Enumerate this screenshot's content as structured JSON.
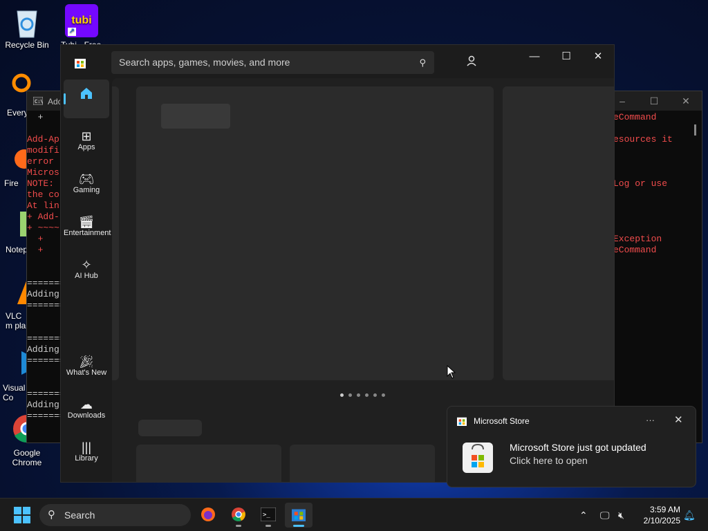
{
  "desktop": {
    "icons": [
      {
        "label": "Recycle Bin"
      },
      {
        "label": "Tubi - Free M..."
      },
      {
        "label": "Every"
      },
      {
        "label": "Fire"
      },
      {
        "label": "Notep"
      },
      {
        "label": "VLC m pla"
      },
      {
        "label": "Visual Co"
      },
      {
        "label": "Google Chrome"
      }
    ],
    "tubi_logo_text": "tubi"
  },
  "terminal": {
    "title": "Adc",
    "left_lines": [
      "  +",
      "",
      "Add-Ap",
      "modifi",
      "error",
      "Micros",
      "NOTE:",
      "the co",
      "At lin",
      "+ Add-",
      "+ ~~~~",
      "  +",
      "  +",
      "",
      "",
      "=======",
      "Adding",
      "=======",
      "",
      "",
      "=======",
      "Adding",
      "=======",
      "",
      "",
      "=======",
      "Adding",
      "======="
    ],
    "right_lines": [
      "eCommand",
      "",
      "esources it",
      "",
      "",
      "",
      "Log or use",
      "",
      "",
      "",
      "",
      "Exception",
      "eCommand"
    ]
  },
  "store": {
    "search_placeholder": "Search apps, games, movies, and more",
    "nav": [
      {
        "label": "",
        "icon": "home-icon",
        "active": true
      },
      {
        "label": "Apps",
        "icon": "apps-icon"
      },
      {
        "label": "Gaming",
        "icon": "gamepad-icon"
      },
      {
        "label": "Entertainment",
        "icon": "clapperboard-icon"
      },
      {
        "label": "AI Hub",
        "icon": "sparkle-icon"
      },
      {
        "label": "What's New",
        "icon": "party-popper-icon"
      },
      {
        "label": "Downloads",
        "icon": "cloud-download-icon"
      },
      {
        "label": "Library",
        "icon": "library-icon"
      }
    ]
  },
  "notification": {
    "app_name": "Microsoft Store",
    "title": "Microsoft Store just got updated",
    "subtitle": "Click here to open"
  },
  "taskbar": {
    "search_label": "Search",
    "time": "3:59 AM",
    "date": "2/10/2025"
  },
  "colors": {
    "accent": "#4cc2ff",
    "terminal_error": "#f14c4c"
  }
}
